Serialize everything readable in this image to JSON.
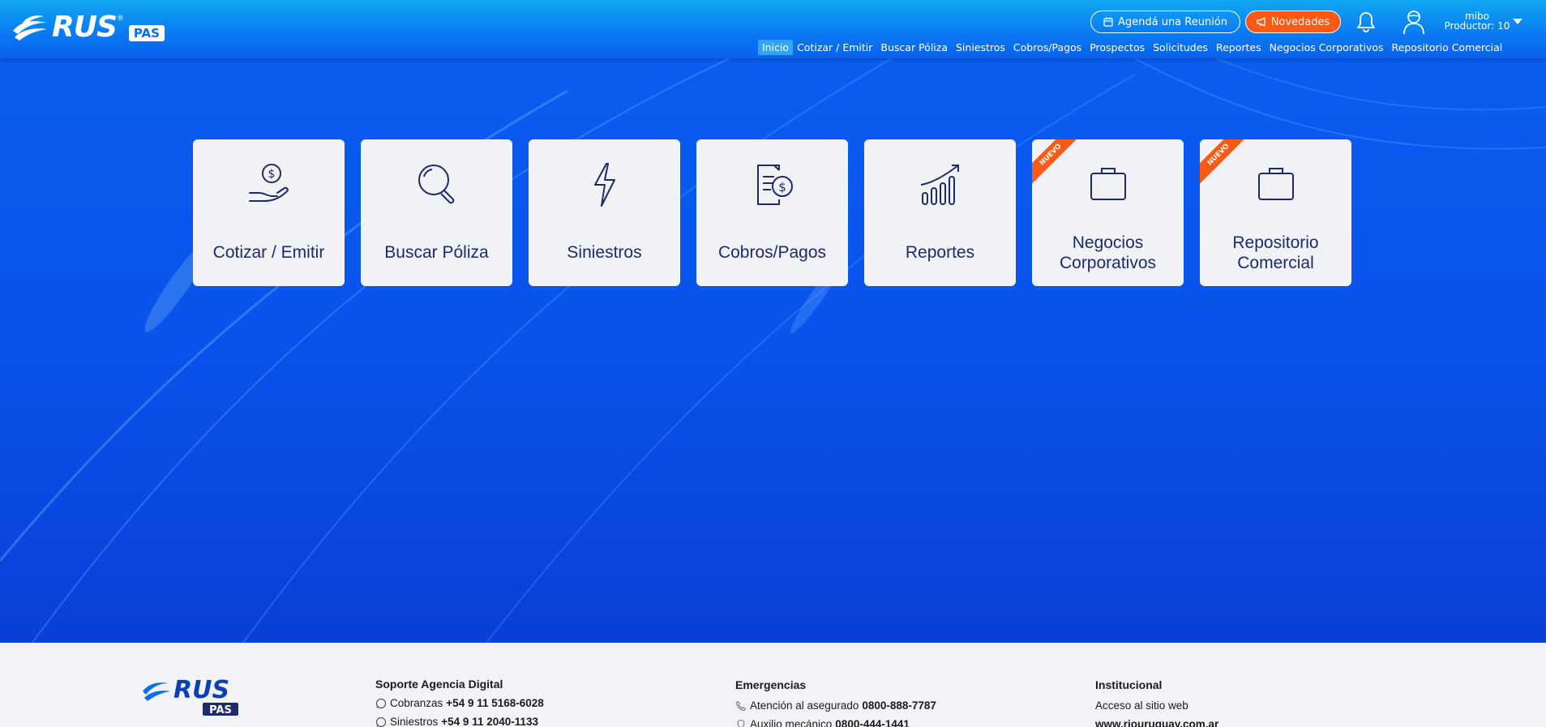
{
  "brand": {
    "name": "RUS",
    "reg": "®",
    "badge": "PAS"
  },
  "header": {
    "meeting_button": "Agendá una Reunión",
    "news_button": "Novedades",
    "user": {
      "name": "mibo",
      "role": "Productor: 10"
    }
  },
  "nav": {
    "items": [
      {
        "label": "Inicio",
        "active": true
      },
      {
        "label": "Cotizar / Emitir"
      },
      {
        "label": "Buscar Póliza"
      },
      {
        "label": "Siniestros"
      },
      {
        "label": "Cobros/Pagos"
      },
      {
        "label": "Prospectos"
      },
      {
        "label": "Solicitudes"
      },
      {
        "label": "Reportes"
      },
      {
        "label": "Negocios Corporativos"
      },
      {
        "label": "Repositorio Comercial"
      }
    ]
  },
  "cards": [
    {
      "label": "Cotizar / Emitir",
      "icon": "hand-coin-icon"
    },
    {
      "label": "Buscar Póliza",
      "icon": "search-icon"
    },
    {
      "label": "Siniestros",
      "icon": "lightning-icon"
    },
    {
      "label": "Cobros/Pagos",
      "icon": "invoice-dollar-icon"
    },
    {
      "label": "Reportes",
      "icon": "bar-chart-icon"
    },
    {
      "label_line1": "Negocios",
      "label_line2": "Corporativos",
      "icon": "briefcase-icon",
      "ribbon": "NUEVO"
    },
    {
      "label_line1": "Repositorio",
      "label_line2": "Comercial",
      "icon": "briefcase-icon",
      "ribbon": "NUEVO"
    }
  ],
  "footer": {
    "support": {
      "title": "Soporte Agencia Digital",
      "lines": [
        {
          "label": "Cobranzas",
          "value": "+54 9 11 5168-6028"
        },
        {
          "label": "Siniestros",
          "value": "+54 9 11 2040-1133"
        }
      ]
    },
    "emergencies": {
      "title": "Emergencias",
      "lines": [
        {
          "label": "Atención al asegurado",
          "value": "0800-888-7787"
        },
        {
          "label": "Auxilio mecánico",
          "value": "0800-444-1441"
        }
      ]
    },
    "institutional": {
      "title": "Institucional",
      "text": "Acceso al sitio web",
      "link": "www.riouruguay.com.ar"
    }
  },
  "colors": {
    "header_top": "#10a8f3",
    "hero_blue": "#0a52ec",
    "accent_orange": "#fa5a14",
    "card_bg": "#f0f2f6",
    "card_text": "#1d2a6b"
  }
}
